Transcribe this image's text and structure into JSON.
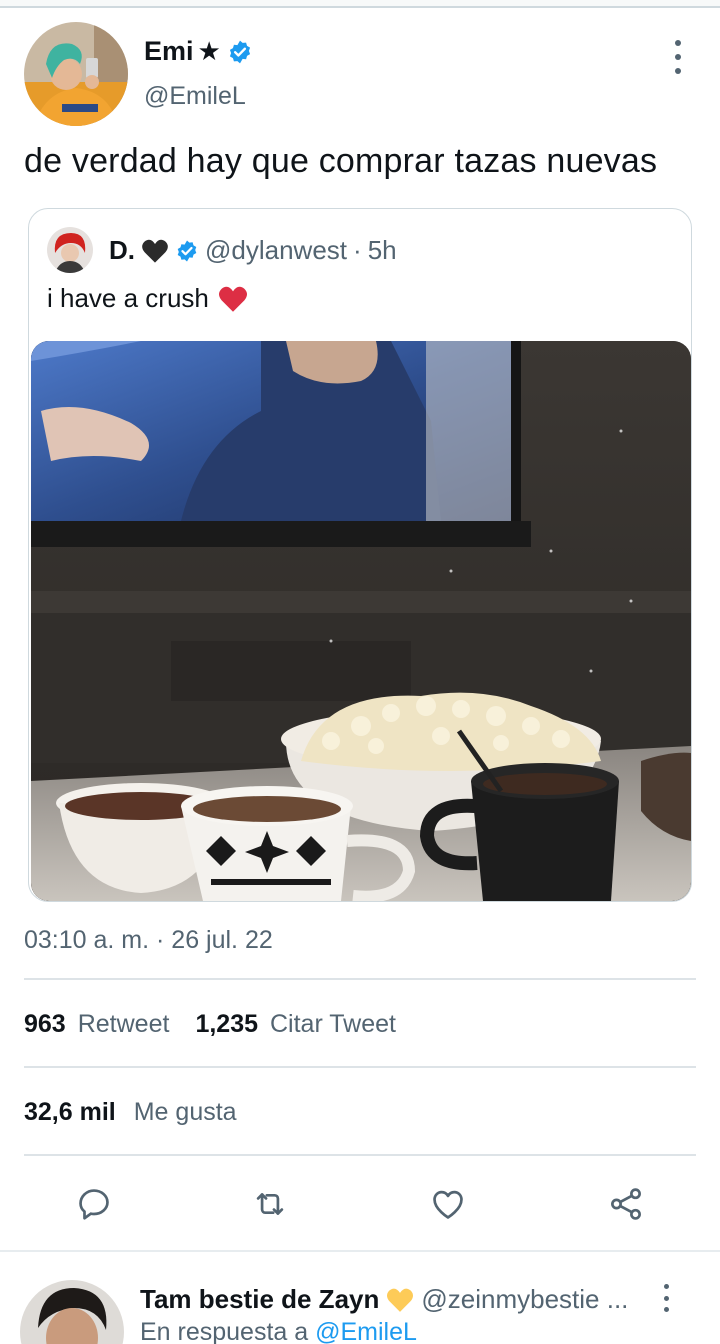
{
  "tweet": {
    "author": {
      "name": "Emi",
      "name_glyph": "★",
      "handle": "@EmileL",
      "verified": true
    },
    "text": "de verdad hay que comprar tazas nuevas",
    "quoted": {
      "name": "D.",
      "heart_glyph": "🖤",
      "handle": "@dylanwest",
      "separator": "·",
      "age": "5h",
      "text": "i have a crush",
      "text_emoji": "❤️"
    },
    "timestamp": "03:10 a. m. · 26 jul. 22",
    "stats": {
      "retweets_count": "963",
      "retweets_label": "Retweet",
      "quotes_count": "1,235",
      "quotes_label": "Citar Tweet",
      "likes_count": "32,6 mil",
      "likes_label": "Me gusta"
    },
    "actions": [
      "reply-icon",
      "retweet-icon",
      "like-icon",
      "share-icon"
    ]
  },
  "reply": {
    "name": "Tam bestie de Zayn",
    "name_emoji": "💛",
    "handle": "@zeinmybestie ...",
    "replying_prefix": "En respuesta a",
    "replying_to": "@EmileL"
  },
  "colors": {
    "text": "#0f1419",
    "secondary": "#536471",
    "verified": "#1d9bf0",
    "divider": "#dde3e7",
    "heart": "#e0245e"
  }
}
